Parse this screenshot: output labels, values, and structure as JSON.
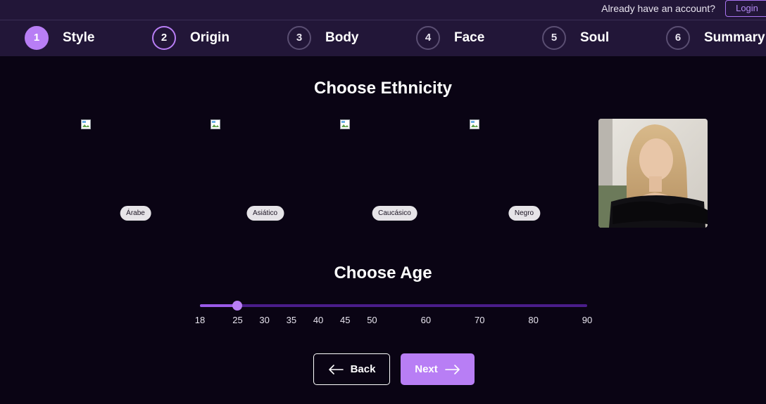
{
  "account": {
    "prompt": "Already have an account?",
    "login_label": "Login"
  },
  "steps": [
    {
      "number": "1",
      "label": "Style",
      "state": "done"
    },
    {
      "number": "2",
      "label": "Origin",
      "state": "active"
    },
    {
      "number": "3",
      "label": "Body",
      "state": "pending"
    },
    {
      "number": "4",
      "label": "Face",
      "state": "pending"
    },
    {
      "number": "5",
      "label": "Soul",
      "state": "pending"
    },
    {
      "number": "6",
      "label": "Summary",
      "state": "pending"
    }
  ],
  "ethnicity": {
    "title": "Choose Ethnicity",
    "options": [
      {
        "label": "Árabe",
        "icon": "broken-image-icon"
      },
      {
        "label": "Asiático",
        "icon": "broken-image-icon"
      },
      {
        "label": "Caucásico",
        "icon": "broken-image-icon"
      },
      {
        "label": "Negro",
        "icon": "broken-image-icon"
      }
    ],
    "preview_icon": "portrait-photo"
  },
  "age": {
    "title": "Choose Age",
    "min": 18,
    "max": 90,
    "value": 25,
    "ticks": [
      "18",
      "25",
      "30",
      "35",
      "40",
      "45",
      "50",
      "60",
      "70",
      "80",
      "90"
    ]
  },
  "nav": {
    "back_label": "Back",
    "next_label": "Next",
    "back_icon": "arrow-left-icon",
    "next_icon": "arrow-right-icon"
  },
  "colors": {
    "accent": "#b87ef5",
    "background": "#0a0414",
    "header": "#221638",
    "track": "#4a1d8a"
  }
}
